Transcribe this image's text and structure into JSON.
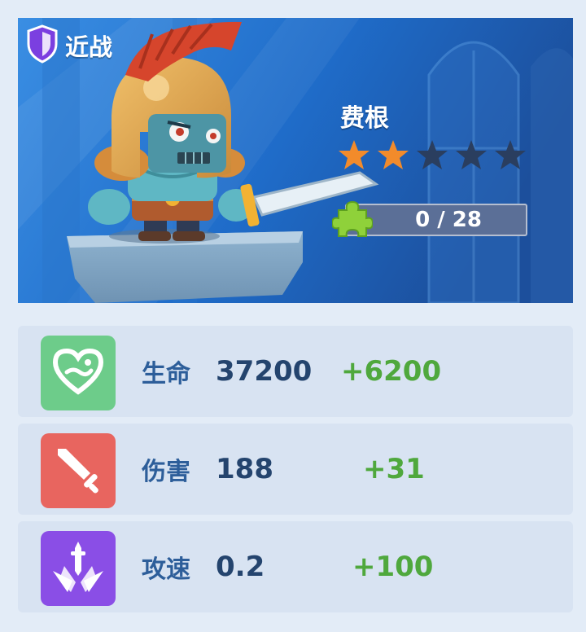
{
  "hero": {
    "type_label": "近战",
    "type_icon": "shield-icon",
    "name": "费根",
    "stars_filled": 2,
    "stars_total": 5,
    "shards_text": "0 / 28",
    "shards_icon": "puzzle-piece-icon",
    "portrait": "spartan-warrior-with-sword"
  },
  "stats": [
    {
      "label": "生命",
      "value": "37200",
      "bonus": "+6200",
      "icon": "heart-icon",
      "color": "#6dcc8a"
    },
    {
      "label": "伤害",
      "value": "188",
      "bonus": "+31",
      "icon": "sword-icon",
      "color": "#e8655f"
    },
    {
      "label": "攻速",
      "value": "0.2",
      "bonus": "+100",
      "icon": "speed-sword-icon",
      "color": "#8a4ee6"
    }
  ],
  "colors": {
    "star_filled": "#f28b2b",
    "star_empty": "#2a3e5f",
    "bonus_green": "#4fa83d",
    "label_blue": "#2d5e9a"
  }
}
